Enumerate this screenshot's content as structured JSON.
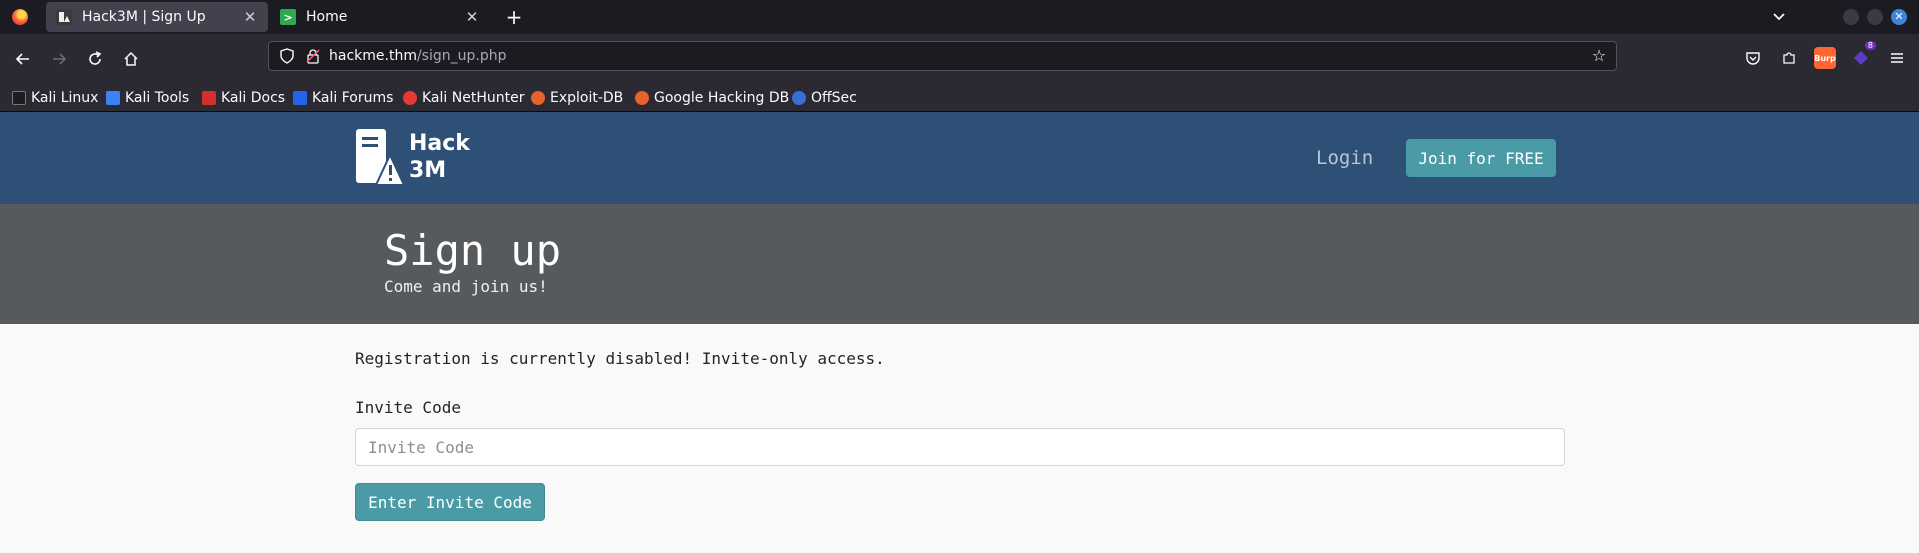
{
  "browser": {
    "tabs": [
      {
        "title": "Hack3M | Sign Up",
        "active": true,
        "icon": "hack3m-favicon"
      },
      {
        "title": "Home",
        "active": false,
        "icon": "terminal-favicon"
      }
    ],
    "url": {
      "domain": "hackme.thm",
      "path": "/sign_up.php"
    },
    "extension_badge": "8",
    "extension_burp_label": "Burp",
    "bookmarks": [
      {
        "label": "Kali Linux",
        "icon": "kali-dragon-icon"
      },
      {
        "label": "Kali Tools",
        "icon": "kali-tools-icon"
      },
      {
        "label": "Kali Docs",
        "icon": "kali-docs-icon"
      },
      {
        "label": "Kali Forums",
        "icon": "kali-forums-icon"
      },
      {
        "label": "Kali NetHunter",
        "icon": "nethunter-icon"
      },
      {
        "label": "Exploit-DB",
        "icon": "exploit-db-icon"
      },
      {
        "label": "Google Hacking DB",
        "icon": "ghdb-icon"
      },
      {
        "label": "OffSec",
        "icon": "offsec-icon"
      }
    ]
  },
  "header": {
    "logo_line1": "Hack",
    "logo_line2": "3M",
    "login_label": "Login",
    "join_label": "Join for FREE"
  },
  "hero": {
    "title": "Sign up",
    "subtitle": "Come and join us!"
  },
  "form": {
    "notice": "Registration is currently disabled! Invite-only access.",
    "invite_label": "Invite Code",
    "invite_placeholder": "Invite Code",
    "invite_value": "",
    "submit_label": "Enter Invite Code"
  },
  "colors": {
    "header_bg": "#2e5077",
    "hero_bg": "#575a5d",
    "accent": "#4a9ba5"
  }
}
